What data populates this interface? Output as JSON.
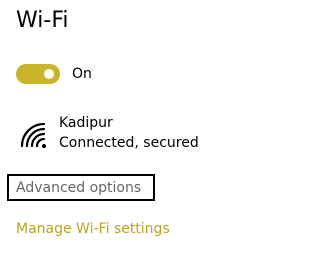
{
  "title": "Wi-Fi",
  "wifi_toggle": {
    "state": "on",
    "label": "On",
    "accent_color": "#c8b52a",
    "knob_color": "#ffffff"
  },
  "network": {
    "icon": "wifi-signal-icon",
    "name": "Kadipur",
    "status": "Connected, secured"
  },
  "advanced_options": {
    "label": "Advanced options",
    "label_color": "#666666",
    "focus_border_color": "#000000"
  },
  "manage_link": {
    "label": "Manage Wi-Fi settings",
    "color": "#b9a51c"
  }
}
